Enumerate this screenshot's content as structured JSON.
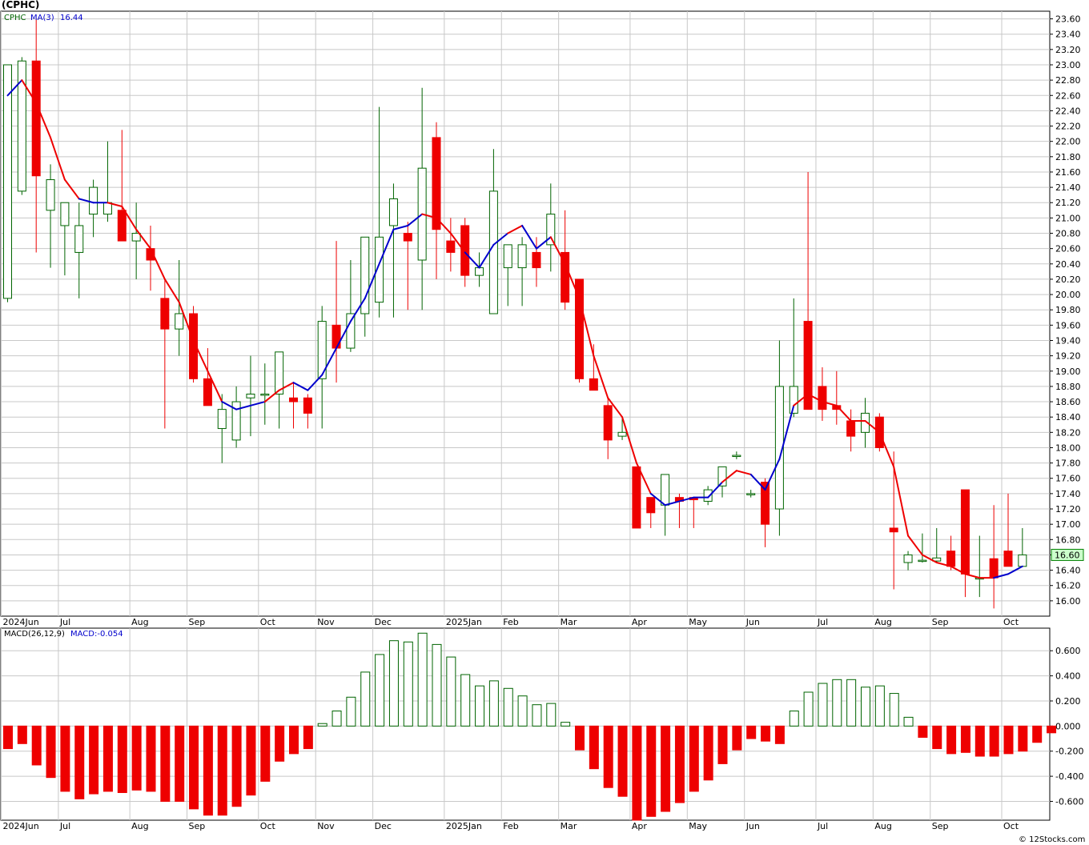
{
  "header": {
    "title": "(CPHC)",
    "ticker_label": "CPHC",
    "ma_label": "MA(3)",
    "ma_value": "16.44",
    "macd_label": "MACD(26,12,9)",
    "macd_value_label": "MACD:-0.054",
    "watermark": "© 12Stocks.com",
    "last_price_tag": "16.60"
  },
  "colors": {
    "up_fill": "#ffffff",
    "up_stroke": "#006400",
    "down": "#ee0000",
    "ma_down": "#ee0000",
    "ma_up": "#0000cc",
    "grid": "#c8c8c8",
    "price_tag_bg": "#ccffcc"
  },
  "chart_data": [
    {
      "type": "candlestick",
      "ylim": [
        15.8,
        23.7
      ],
      "y_ticks": [
        "23.60",
        "23.40",
        "23.20",
        "23.00",
        "22.80",
        "22.60",
        "22.40",
        "22.20",
        "22.00",
        "21.80",
        "21.60",
        "21.40",
        "21.20",
        "21.00",
        "20.80",
        "20.60",
        "20.40",
        "20.20",
        "20.00",
        "19.80",
        "19.60",
        "19.40",
        "19.20",
        "19.00",
        "18.80",
        "18.60",
        "18.40",
        "18.20",
        "18.00",
        "17.80",
        "17.60",
        "17.40",
        "17.20",
        "17.00",
        "16.80",
        "16.60",
        "16.40",
        "16.20",
        "16.00"
      ],
      "x_ticks": [
        {
          "label": "2024Jun",
          "index": 0
        },
        {
          "label": "Jul",
          "index": 4
        },
        {
          "label": "Aug",
          "index": 9
        },
        {
          "label": "Sep",
          "index": 13
        },
        {
          "label": "Oct",
          "index": 18
        },
        {
          "label": "Nov",
          "index": 22
        },
        {
          "label": "Dec",
          "index": 26
        },
        {
          "label": "2025Jan",
          "index": 31
        },
        {
          "label": "Feb",
          "index": 35
        },
        {
          "label": "Mar",
          "index": 39
        },
        {
          "label": "Apr",
          "index": 44
        },
        {
          "label": "May",
          "index": 48
        },
        {
          "label": "Jun",
          "index": 52
        },
        {
          "label": "Jul",
          "index": 57
        },
        {
          "label": "Aug",
          "index": 61
        },
        {
          "label": "Sep",
          "index": 65
        },
        {
          "label": "Oct",
          "index": 70
        }
      ],
      "candles": [
        {
          "o": 19.95,
          "h": 23.0,
          "l": 19.9,
          "c": 23.0
        },
        {
          "o": 21.35,
          "h": 23.1,
          "l": 21.3,
          "c": 23.05
        },
        {
          "o": 23.05,
          "h": 23.6,
          "l": 20.55,
          "c": 21.55
        },
        {
          "o": 21.1,
          "h": 21.7,
          "l": 20.35,
          "c": 21.5
        },
        {
          "o": 20.9,
          "h": 21.2,
          "l": 20.25,
          "c": 21.2
        },
        {
          "o": 20.55,
          "h": 21.2,
          "l": 19.95,
          "c": 20.9
        },
        {
          "o": 21.05,
          "h": 21.5,
          "l": 20.75,
          "c": 21.4
        },
        {
          "o": 21.05,
          "h": 22.0,
          "l": 20.95,
          "c": 21.2
        },
        {
          "o": 21.1,
          "h": 22.15,
          "l": 20.7,
          "c": 20.7
        },
        {
          "o": 20.7,
          "h": 21.2,
          "l": 20.2,
          "c": 20.8
        },
        {
          "o": 20.6,
          "h": 20.9,
          "l": 20.05,
          "c": 20.45
        },
        {
          "o": 19.95,
          "h": 20.2,
          "l": 18.25,
          "c": 19.55
        },
        {
          "o": 19.55,
          "h": 20.45,
          "l": 19.2,
          "c": 19.75
        },
        {
          "o": 19.75,
          "h": 19.85,
          "l": 18.85,
          "c": 18.9
        },
        {
          "o": 18.9,
          "h": 19.3,
          "l": 18.55,
          "c": 18.55
        },
        {
          "o": 18.25,
          "h": 18.7,
          "l": 17.8,
          "c": 18.5
        },
        {
          "o": 18.1,
          "h": 18.8,
          "l": 18.0,
          "c": 18.6
        },
        {
          "o": 18.65,
          "h": 19.2,
          "l": 18.15,
          "c": 18.7
        },
        {
          "o": 18.7,
          "h": 19.1,
          "l": 18.3,
          "c": 18.7
        },
        {
          "o": 18.7,
          "h": 19.25,
          "l": 18.25,
          "c": 19.25
        },
        {
          "o": 18.65,
          "h": 18.85,
          "l": 18.25,
          "c": 18.6
        },
        {
          "o": 18.65,
          "h": 18.7,
          "l": 18.25,
          "c": 18.45
        },
        {
          "o": 18.9,
          "h": 19.85,
          "l": 18.25,
          "c": 19.65
        },
        {
          "o": 19.6,
          "h": 20.7,
          "l": 18.85,
          "c": 19.3
        },
        {
          "o": 19.3,
          "h": 20.45,
          "l": 19.25,
          "c": 19.75
        },
        {
          "o": 19.75,
          "h": 20.75,
          "l": 19.45,
          "c": 20.75
        },
        {
          "o": 19.9,
          "h": 22.45,
          "l": 19.7,
          "c": 20.75
        },
        {
          "o": 20.9,
          "h": 21.45,
          "l": 19.7,
          "c": 21.25
        },
        {
          "o": 20.8,
          "h": 20.95,
          "l": 19.8,
          "c": 20.7
        },
        {
          "o": 20.45,
          "h": 22.7,
          "l": 19.8,
          "c": 21.65
        },
        {
          "o": 22.05,
          "h": 22.25,
          "l": 20.2,
          "c": 20.85
        },
        {
          "o": 20.7,
          "h": 21.0,
          "l": 20.3,
          "c": 20.55
        },
        {
          "o": 20.9,
          "h": 21.0,
          "l": 20.1,
          "c": 20.25
        },
        {
          "o": 20.25,
          "h": 20.55,
          "l": 20.1,
          "c": 20.35
        },
        {
          "o": 19.75,
          "h": 21.9,
          "l": 19.75,
          "c": 21.35
        },
        {
          "o": 20.35,
          "h": 20.65,
          "l": 19.85,
          "c": 20.65
        },
        {
          "o": 20.35,
          "h": 20.75,
          "l": 19.85,
          "c": 20.65
        },
        {
          "o": 20.55,
          "h": 20.75,
          "l": 20.1,
          "c": 20.35
        },
        {
          "o": 20.65,
          "h": 21.45,
          "l": 20.3,
          "c": 21.05
        },
        {
          "o": 20.55,
          "h": 21.1,
          "l": 19.8,
          "c": 19.9
        },
        {
          "o": 20.2,
          "h": 20.2,
          "l": 18.85,
          "c": 18.9
        },
        {
          "o": 18.9,
          "h": 19.35,
          "l": 18.75,
          "c": 18.75
        },
        {
          "o": 18.55,
          "h": 18.65,
          "l": 17.85,
          "c": 18.1
        },
        {
          "o": 18.15,
          "h": 18.4,
          "l": 18.1,
          "c": 18.2
        },
        {
          "o": 17.75,
          "h": 17.75,
          "l": 16.95,
          "c": 16.95
        },
        {
          "o": 17.35,
          "h": 17.35,
          "l": 16.95,
          "c": 17.15
        },
        {
          "o": 17.25,
          "h": 17.65,
          "l": 16.85,
          "c": 17.65
        },
        {
          "o": 17.35,
          "h": 17.4,
          "l": 16.95,
          "c": 17.3
        },
        {
          "o": 17.35,
          "h": 17.35,
          "l": 16.95,
          "c": 17.32
        },
        {
          "o": 17.3,
          "h": 17.5,
          "l": 17.25,
          "c": 17.45
        },
        {
          "o": 17.5,
          "h": 17.75,
          "l": 17.35,
          "c": 17.75
        },
        {
          "o": 17.9,
          "h": 17.95,
          "l": 17.85,
          "c": 17.9
        },
        {
          "o": 17.4,
          "h": 17.45,
          "l": 17.35,
          "c": 17.4
        },
        {
          "o": 17.55,
          "h": 17.6,
          "l": 16.7,
          "c": 17.0
        },
        {
          "o": 17.2,
          "h": 19.4,
          "l": 16.85,
          "c": 18.8
        },
        {
          "o": 18.45,
          "h": 19.95,
          "l": 18.4,
          "c": 18.8
        },
        {
          "o": 19.65,
          "h": 21.6,
          "l": 18.5,
          "c": 18.5
        },
        {
          "o": 18.8,
          "h": 19.05,
          "l": 18.35,
          "c": 18.5
        },
        {
          "o": 18.55,
          "h": 19.0,
          "l": 18.3,
          "c": 18.5
        },
        {
          "o": 18.35,
          "h": 18.5,
          "l": 17.95,
          "c": 18.15
        },
        {
          "o": 18.2,
          "h": 18.65,
          "l": 18.0,
          "c": 18.45
        },
        {
          "o": 18.4,
          "h": 18.45,
          "l": 17.95,
          "c": 18.0
        },
        {
          "o": 16.95,
          "h": 17.95,
          "l": 16.15,
          "c": 16.9
        },
        {
          "o": 16.5,
          "h": 16.65,
          "l": 16.4,
          "c": 16.6
        },
        {
          "o": 16.53,
          "h": 16.88,
          "l": 16.5,
          "c": 16.53
        },
        {
          "o": 16.52,
          "h": 16.95,
          "l": 16.5,
          "c": 16.56
        },
        {
          "o": 16.65,
          "h": 16.85,
          "l": 16.4,
          "c": 16.45
        },
        {
          "o": 17.45,
          "h": 17.45,
          "l": 16.05,
          "c": 16.35
        },
        {
          "o": 16.3,
          "h": 16.85,
          "l": 16.05,
          "c": 16.3
        },
        {
          "o": 16.55,
          "h": 17.25,
          "l": 15.9,
          "c": 16.3
        },
        {
          "o": 16.65,
          "h": 17.4,
          "l": 16.45,
          "c": 16.45
        },
        {
          "o": 16.45,
          "h": 16.95,
          "l": 16.45,
          "c": 16.6
        }
      ],
      "ma": [
        22.6,
        22.8,
        22.5,
        22.05,
        21.5,
        21.25,
        21.2,
        21.2,
        21.15,
        20.85,
        20.6,
        20.2,
        19.9,
        19.4,
        19.0,
        18.6,
        18.5,
        18.55,
        18.6,
        18.75,
        18.85,
        18.75,
        18.95,
        19.3,
        19.65,
        19.95,
        20.4,
        20.85,
        20.9,
        21.05,
        21.0,
        20.8,
        20.55,
        20.35,
        20.65,
        20.8,
        20.9,
        20.6,
        20.75,
        20.4,
        19.95,
        19.2,
        18.65,
        18.4,
        17.8,
        17.4,
        17.25,
        17.3,
        17.35,
        17.35,
        17.55,
        17.7,
        17.65,
        17.45,
        17.85,
        18.55,
        18.7,
        18.6,
        18.55,
        18.35,
        18.35,
        18.2,
        17.75,
        16.85,
        16.6,
        16.5,
        16.45,
        16.35,
        16.3,
        16.3,
        16.35,
        16.45
      ],
      "ma_color": [
        "up",
        "up",
        "down",
        "down",
        "down",
        "down",
        "up",
        "up",
        "down",
        "down",
        "down",
        "down",
        "down",
        "down",
        "down",
        "down",
        "up",
        "up",
        "up",
        "down",
        "down",
        "up",
        "up",
        "up",
        "up",
        "up",
        "up",
        "up",
        "up",
        "up",
        "down",
        "down",
        "down",
        "up",
        "up",
        "up",
        "down",
        "up",
        "up",
        "down",
        "down",
        "down",
        "down",
        "down",
        "down",
        "down",
        "up",
        "up",
        "up",
        "up",
        "up",
        "down",
        "down",
        "up",
        "up",
        "up",
        "down",
        "down",
        "down",
        "down",
        "down",
        "down",
        "down",
        "down",
        "down",
        "down",
        "down",
        "down",
        "down",
        "down",
        "up",
        "up"
      ]
    },
    {
      "type": "bar",
      "title": "MACD(26,12,9)",
      "ylim": [
        -0.75,
        0.78
      ],
      "y_ticks": [
        "0.600",
        "0.400",
        "0.200",
        "0.000",
        "-0.200",
        "-0.400",
        "-0.600"
      ],
      "values": [
        -0.18,
        -0.14,
        -0.31,
        -0.41,
        -0.52,
        -0.58,
        -0.54,
        -0.52,
        -0.53,
        -0.51,
        -0.52,
        -0.6,
        -0.6,
        -0.66,
        -0.71,
        -0.71,
        -0.64,
        -0.55,
        -0.44,
        -0.28,
        -0.22,
        -0.18,
        0.02,
        0.12,
        0.23,
        0.43,
        0.57,
        0.68,
        0.67,
        0.74,
        0.65,
        0.55,
        0.41,
        0.32,
        0.36,
        0.3,
        0.24,
        0.17,
        0.18,
        0.03,
        -0.19,
        -0.34,
        -0.49,
        -0.56,
        -0.75,
        -0.72,
        -0.68,
        -0.61,
        -0.52,
        -0.43,
        -0.3,
        -0.19,
        -0.1,
        -0.12,
        -0.14,
        0.12,
        0.27,
        0.34,
        0.37,
        0.37,
        0.31,
        0.32,
        0.26,
        0.07,
        -0.09,
        -0.18,
        -0.22,
        -0.21,
        -0.24,
        -0.24,
        -0.22,
        -0.2,
        -0.13,
        -0.054
      ]
    }
  ]
}
